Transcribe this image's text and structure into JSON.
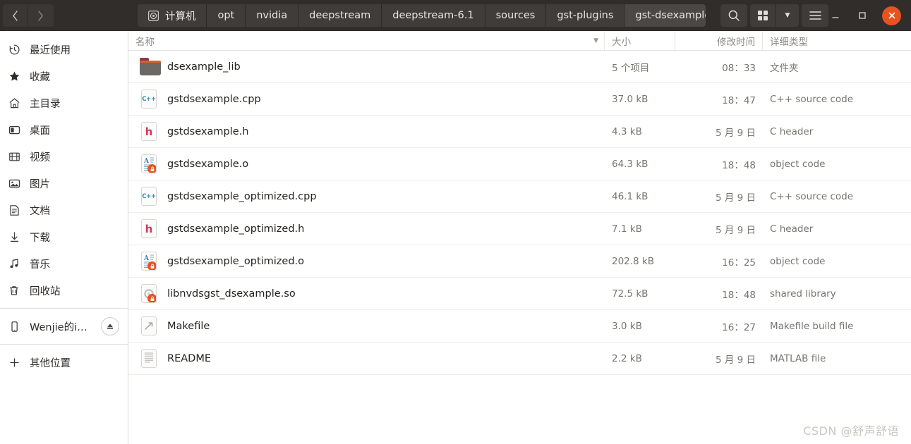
{
  "header": {
    "nav": {
      "back_label": "‹",
      "back_name": "back-button",
      "forward_label": "›",
      "forward_name": "forward-button"
    },
    "breadcrumbs": [
      {
        "label": "计算机",
        "icon": "disc-icon",
        "active": false
      },
      {
        "label": "opt",
        "active": false
      },
      {
        "label": "nvidia",
        "active": false
      },
      {
        "label": "deepstream",
        "active": false
      },
      {
        "label": "deepstream-6.1",
        "active": false
      },
      {
        "label": "sources",
        "active": false
      },
      {
        "label": "gst-plugins",
        "active": false
      },
      {
        "label": "gst-dsexample",
        "active": true
      }
    ],
    "actions": [
      {
        "name": "search-button",
        "icon": "search-icon"
      },
      {
        "name": "view-grid-button",
        "icon": "grid-icon"
      },
      {
        "name": "view-options-button",
        "icon": "chevron-down-icon"
      },
      {
        "name": "menu-button",
        "icon": "hamburger-icon"
      }
    ],
    "window_controls": [
      {
        "name": "minimize-button",
        "glyph": "—"
      },
      {
        "name": "maximize-button",
        "glyph": "□"
      },
      {
        "name": "close-button",
        "glyph": "✕"
      }
    ]
  },
  "sidebar": {
    "items": [
      {
        "label": "最近使用",
        "icon": "clock-icon",
        "name": "sidebar-item-recent"
      },
      {
        "label": "收藏",
        "icon": "star-icon",
        "name": "sidebar-item-starred"
      },
      {
        "label": "主目录",
        "icon": "home-icon",
        "name": "sidebar-item-home"
      },
      {
        "label": "桌面",
        "icon": "desktop-icon",
        "name": "sidebar-item-desktop"
      },
      {
        "label": "视频",
        "icon": "video-icon",
        "name": "sidebar-item-videos"
      },
      {
        "label": "图片",
        "icon": "image-icon",
        "name": "sidebar-item-pictures"
      },
      {
        "label": "文档",
        "icon": "document-icon",
        "name": "sidebar-item-documents"
      },
      {
        "label": "下载",
        "icon": "download-icon",
        "name": "sidebar-item-downloads"
      },
      {
        "label": "音乐",
        "icon": "music-icon",
        "name": "sidebar-item-music"
      },
      {
        "label": "回收站",
        "icon": "trash-icon",
        "name": "sidebar-item-trash"
      }
    ],
    "device": {
      "label": "Wenjie的iPh…",
      "icon": "phone-icon",
      "eject_icon": "eject-icon"
    },
    "other": {
      "label": "其他位置",
      "icon": "plus-icon"
    }
  },
  "columns": {
    "name": "名称",
    "size": "大小",
    "modified": "修改时间",
    "type": "详细类型",
    "sort_caret": "▼"
  },
  "files": [
    {
      "name": "dsexample_lib",
      "size": "5 个项目",
      "modified": "08：33",
      "type": "文件夹",
      "icon": "folder-icon"
    },
    {
      "name": "gstdsexample.cpp",
      "size": "37.0 kB",
      "modified": "18：47",
      "type": "C++ source code",
      "icon": "cpp-file-icon"
    },
    {
      "name": "gstdsexample.h",
      "size": "4.3 kB",
      "modified": "5 月 9 日",
      "type": "C header",
      "icon": "h-file-icon"
    },
    {
      "name": "gstdsexample.o",
      "size": "64.3 kB",
      "modified": "18：48",
      "type": "object code",
      "icon": "object-file-icon"
    },
    {
      "name": "gstdsexample_optimized.cpp",
      "size": "46.1 kB",
      "modified": "5 月 9 日",
      "type": "C++ source code",
      "icon": "cpp-file-icon"
    },
    {
      "name": "gstdsexample_optimized.h",
      "size": "7.1 kB",
      "modified": "5 月 9 日",
      "type": "C header",
      "icon": "h-file-icon"
    },
    {
      "name": "gstdsexample_optimized.o",
      "size": "202.8 kB",
      "modified": "16：25",
      "type": "object code",
      "icon": "object-file-icon"
    },
    {
      "name": "libnvdsgst_dsexample.so",
      "size": "72.5 kB",
      "modified": "18：48",
      "type": "shared library",
      "icon": "library-file-icon"
    },
    {
      "name": "Makefile",
      "size": "3.0 kB",
      "modified": "16：27",
      "type": "Makefile build file",
      "icon": "makefile-icon"
    },
    {
      "name": "README",
      "size": "2.2 kB",
      "modified": "5 月 9 日",
      "type": "MATLAB file",
      "icon": "text-file-icon"
    }
  ],
  "watermark": "CSDN @舒声舒语",
  "colors": {
    "headerbar": "#302d2b",
    "close": "#e8521f",
    "text": "#25221f",
    "muted": "#78746f"
  }
}
